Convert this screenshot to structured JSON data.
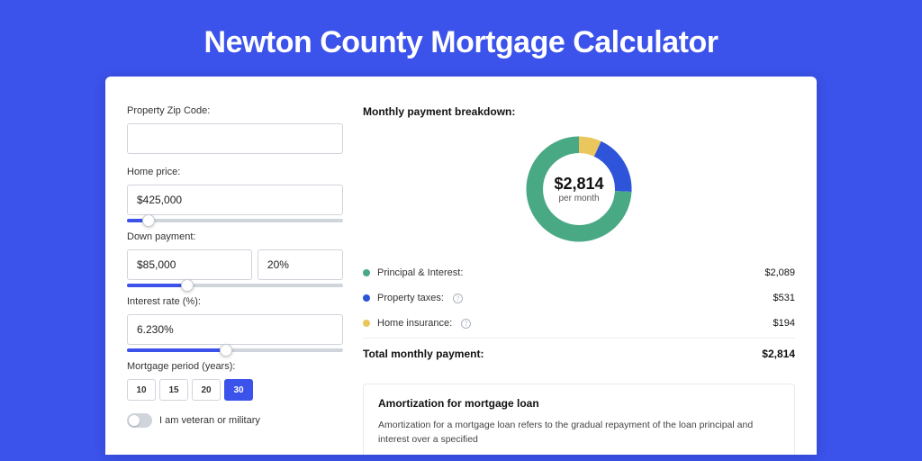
{
  "header": {
    "title": "Newton County Mortgage Calculator"
  },
  "form": {
    "zip": {
      "label": "Property Zip Code:",
      "value": ""
    },
    "home_price": {
      "label": "Home price:",
      "value": "$425,000",
      "slider_pct": 10
    },
    "down_payment": {
      "label": "Down payment:",
      "amount": "$85,000",
      "percent": "20%",
      "slider_pct": 28
    },
    "interest_rate": {
      "label": "Interest rate (%):",
      "value": "6.230%",
      "slider_pct": 46
    },
    "period": {
      "label": "Mortgage period (years):",
      "options": [
        "10",
        "15",
        "20",
        "30"
      ],
      "selected": "30"
    },
    "veteran": {
      "label": "I am veteran or military",
      "on": false
    }
  },
  "breakdown": {
    "title": "Monthly payment breakdown:",
    "center_value": "$2,814",
    "center_sub": "per month",
    "items": [
      {
        "label": "Principal & Interest:",
        "value": "$2,089",
        "color": "#4aa985",
        "angle": 267,
        "info": false
      },
      {
        "label": "Property taxes:",
        "value": "$531",
        "color": "#2e55d9",
        "angle": 68,
        "info": true
      },
      {
        "label": "Home insurance:",
        "value": "$194",
        "color": "#e9c75c",
        "angle": 25,
        "info": true
      }
    ],
    "total_label": "Total monthly payment:",
    "total_value": "$2,814"
  },
  "amort": {
    "title": "Amortization for mortgage loan",
    "text": "Amortization for a mortgage loan refers to the gradual repayment of the loan principal and interest over a specified"
  },
  "chart_data": {
    "type": "pie",
    "title": "Monthly payment breakdown",
    "categories": [
      "Principal & Interest",
      "Property taxes",
      "Home insurance"
    ],
    "values": [
      2089,
      531,
      194
    ],
    "total": 2814,
    "colors": [
      "#4aa985",
      "#2e55d9",
      "#e9c75c"
    ]
  }
}
